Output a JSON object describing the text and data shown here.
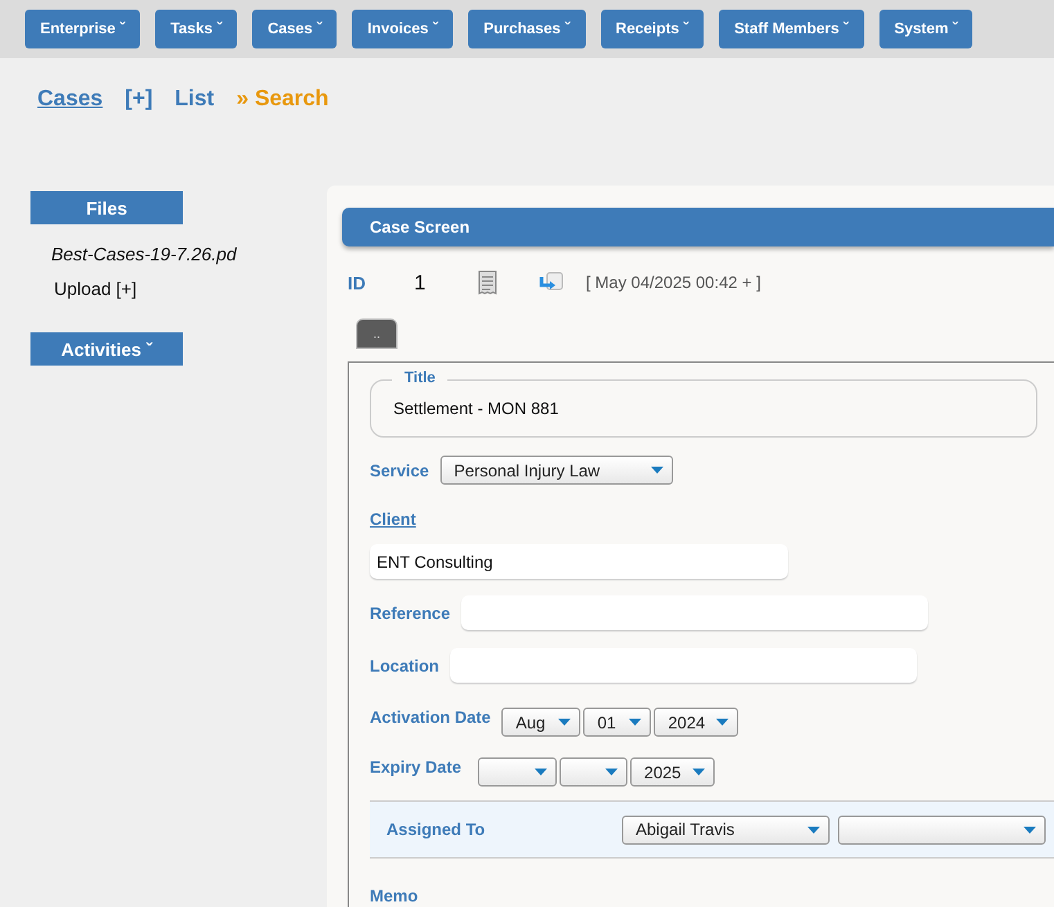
{
  "menu": [
    {
      "label": "Enterprise ˇ"
    },
    {
      "label": "Tasks ˇ"
    },
    {
      "label": "Cases ˇ"
    },
    {
      "label": "Invoices ˇ"
    },
    {
      "label": "Purchases ˇ"
    },
    {
      "label": "Receipts ˇ"
    },
    {
      "label": "Staff Members ˇ"
    },
    {
      "label": "System ˇ"
    }
  ],
  "breadcrumb": {
    "cases": "Cases",
    "add": "[+]",
    "list": "List",
    "current": "» Search"
  },
  "sidebar": {
    "files_title": "Files",
    "file": "Best-Cases-19-7.26.pd",
    "upload": "Upload [+]",
    "activities_title": "Activities ˇ"
  },
  "case": {
    "title": "Case Screen",
    "id_label": "ID",
    "id": "1",
    "timestamp": "[ May 04/2025 00:42 + ]",
    "tab": ".."
  },
  "form": {
    "title_label": "Title",
    "title_value": "Settlement - MON 881",
    "service_label": "Service",
    "service": "Personal Injury Law",
    "client_label": "Client",
    "client": "ENT Consulting",
    "reference_label": "Reference",
    "location_label": "Location",
    "activation_label": "Activation Date",
    "activation": {
      "month": "Aug",
      "day": "01",
      "year": "2024"
    },
    "expiry_label": "Expiry Date",
    "expiry": {
      "year": "2025"
    },
    "assigned_label": "Assigned To",
    "assigned": {
      "primary": "Abigail Travis"
    },
    "memo_label": "Memo"
  }
}
